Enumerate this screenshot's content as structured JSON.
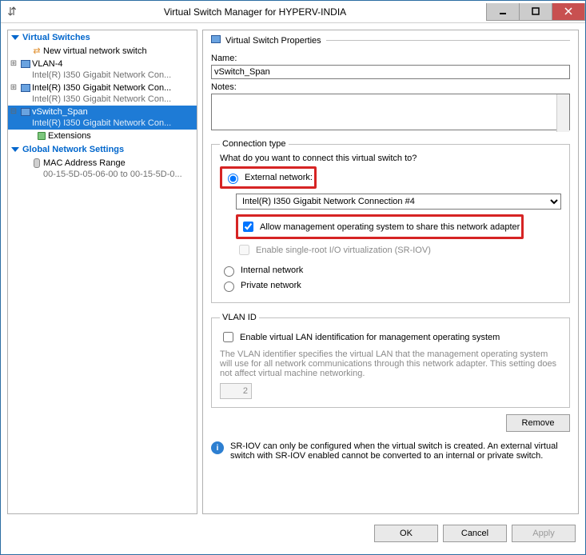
{
  "window": {
    "title": "Virtual Switch Manager for HYPERV-INDIA"
  },
  "sidebar": {
    "sections": {
      "switches": "Virtual Switches",
      "global": "Global Network Settings"
    },
    "new_switch": "New virtual network switch",
    "items": [
      {
        "name": "VLAN-4",
        "sub": "Intel(R) I350 Gigabit Network Con..."
      },
      {
        "name": "Intel(R) I350 Gigabit Network Con...",
        "sub": "Intel(R) I350 Gigabit Network Con..."
      },
      {
        "name": "vSwitch_Span",
        "sub": "Intel(R) I350 Gigabit Network Con..."
      }
    ],
    "extensions": "Extensions",
    "mac": {
      "name": "MAC Address Range",
      "sub": "00-15-5D-05-06-00 to 00-15-5D-0..."
    }
  },
  "props": {
    "header": "Virtual Switch Properties",
    "name_label": "Name:",
    "name_value": "vSwitch_Span",
    "notes_label": "Notes:",
    "conn": {
      "legend": "Connection type",
      "question": "What do you want to connect this virtual switch to?",
      "external": "External network:",
      "adapter": "Intel(R) I350 Gigabit Network Connection #4",
      "allow_mgmt": "Allow management operating system to share this network adapter",
      "sriov": "Enable single-root I/O virtualization (SR-IOV)",
      "internal": "Internal network",
      "private": "Private network"
    },
    "vlan": {
      "legend": "VLAN ID",
      "enable": "Enable virtual LAN identification for management operating system",
      "help": "The VLAN identifier specifies the virtual LAN that the management operating system will use for all network communications through this network adapter. This setting does not affect virtual machine networking.",
      "value": "2"
    },
    "remove": "Remove",
    "sriov_note": "SR-IOV can only be configured when the virtual switch is created. An external virtual switch with SR-IOV enabled cannot be converted to an internal or private switch."
  },
  "footer": {
    "ok": "OK",
    "cancel": "Cancel",
    "apply": "Apply"
  }
}
